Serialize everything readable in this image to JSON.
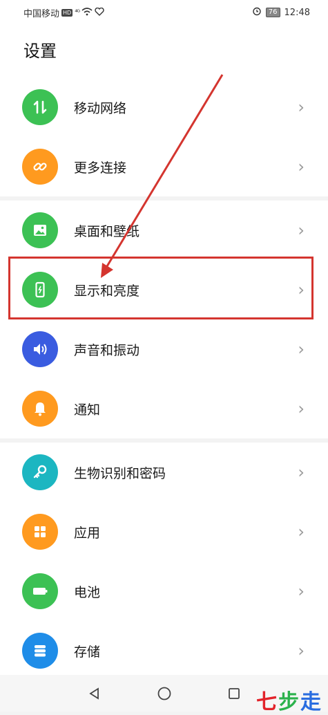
{
  "statusbar": {
    "carrier": "中国移动",
    "hd": "HD",
    "signal": "⁴ᴳ",
    "battery": "76",
    "time": "12:48"
  },
  "header": {
    "title": "设置"
  },
  "groups": [
    {
      "items": [
        {
          "label": "移动网络",
          "icon": "mobile-data-icon",
          "color": "#3cc154"
        },
        {
          "label": "更多连接",
          "icon": "link-icon",
          "color": "#ff9a1f"
        }
      ]
    },
    {
      "items": [
        {
          "label": "桌面和壁纸",
          "icon": "wallpaper-icon",
          "color": "#3cc154"
        },
        {
          "label": "显示和亮度",
          "icon": "display-icon",
          "color": "#3cc154"
        },
        {
          "label": "声音和振动",
          "icon": "sound-icon",
          "color": "#3a5ce0"
        },
        {
          "label": "通知",
          "icon": "bell-icon",
          "color": "#ff9a1f"
        }
      ]
    },
    {
      "items": [
        {
          "label": "生物识别和密码",
          "icon": "key-icon",
          "color": "#1cb6c1"
        },
        {
          "label": "应用",
          "icon": "apps-icon",
          "color": "#ff9a1f"
        },
        {
          "label": "电池",
          "icon": "battery-icon",
          "color": "#3cc154"
        },
        {
          "label": "存储",
          "icon": "storage-icon",
          "color": "#1f8de8"
        }
      ]
    }
  ],
  "chevron": "›",
  "annotation": {
    "color": "#d4352f"
  },
  "watermark": [
    "七",
    "步",
    "走"
  ]
}
